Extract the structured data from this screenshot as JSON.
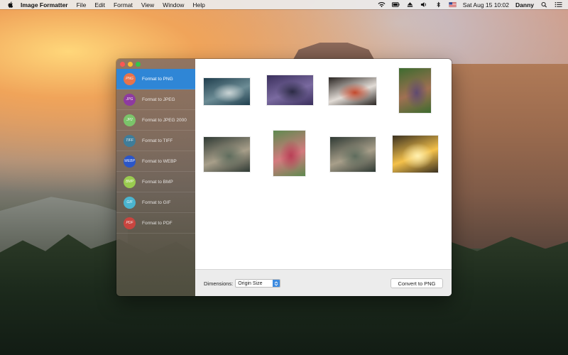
{
  "menubar": {
    "app_name": "Image Formatter",
    "menus": [
      "File",
      "Edit",
      "Format",
      "View",
      "Window",
      "Help"
    ],
    "clock": "Sat Aug 15  10:02",
    "user": "Danny"
  },
  "sidebar": {
    "items": [
      {
        "label": "Format to PNG",
        "badge": "PNG",
        "color": "#e8734a",
        "active": true
      },
      {
        "label": "Format to JPEG",
        "badge": "JPG",
        "color": "#8e3aa0",
        "active": false
      },
      {
        "label": "Format to JPEG 2000",
        "badge": "JP2",
        "color": "#7bc46a",
        "active": false
      },
      {
        "label": "Format to TIFF",
        "badge": "TIFF",
        "color": "#3f7d9a",
        "active": false
      },
      {
        "label": "Format to WEBP",
        "badge": "WEBP",
        "color": "#2b56c8",
        "active": false
      },
      {
        "label": "Format to BMP",
        "badge": "BMP",
        "color": "#9acb4f",
        "active": false
      },
      {
        "label": "Format to GIF",
        "badge": "GIF",
        "color": "#4bb4cf",
        "active": false
      },
      {
        "label": "Format to PDF",
        "badge": "PDF",
        "color": "#c8453f",
        "active": false
      }
    ]
  },
  "thumbnails": [
    {
      "subject": "silver sports car",
      "colors": [
        "#1f3e4d",
        "#6c8c95",
        "#c9d3d4"
      ]
    },
    {
      "subject": "woman with motorcycle",
      "colors": [
        "#3a2f5c",
        "#7a6aa0",
        "#2b2a44"
      ]
    },
    {
      "subject": "orange sports car",
      "colors": [
        "#2a2522",
        "#e2dcd6",
        "#c2472b"
      ]
    },
    {
      "subject": "woman with long hair",
      "colors": [
        "#3d6b2f",
        "#a07052",
        "#5e4a70"
      ]
    },
    {
      "subject": "fairy in forest",
      "colors": [
        "#2f3a34",
        "#a89f8a",
        "#5d6b5c"
      ]
    },
    {
      "subject": "woman in red dress",
      "colors": [
        "#5e8a4f",
        "#d47b7f",
        "#b84056"
      ]
    },
    {
      "subject": "fairy in forest",
      "colors": [
        "#2f3a34",
        "#a89f8a",
        "#5d6b5c"
      ]
    },
    {
      "subject": "woman in sunlight",
      "colors": [
        "#3a3020",
        "#f4c14a",
        "#fff0b0"
      ]
    }
  ],
  "toolbar": {
    "dimensions_label": "Dimensions:",
    "dimensions_value": "Origin Size",
    "convert_label": "Convert to PNG"
  }
}
